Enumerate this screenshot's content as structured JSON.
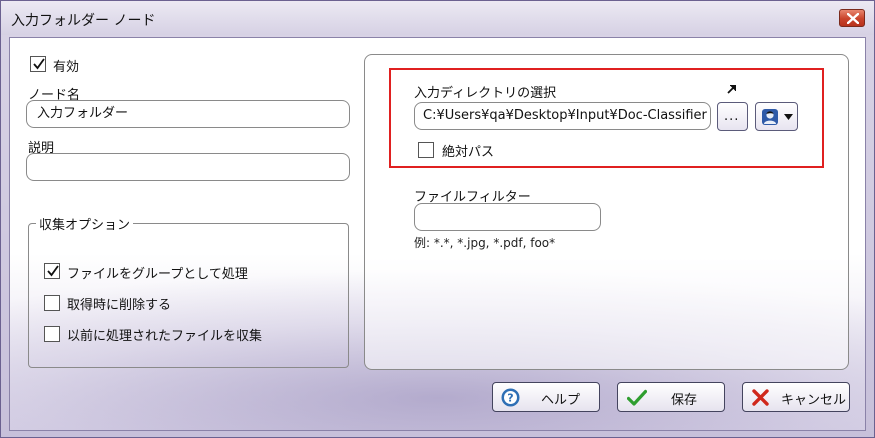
{
  "window": {
    "title": "入力フォルダー ノード"
  },
  "general": {
    "enabled_label": "有効",
    "enabled_checked": true,
    "node_name_label": "ノード名",
    "node_name_value": "入力フォルダー",
    "description_label": "説明",
    "description_value": ""
  },
  "collection_options": {
    "title": "収集オプション",
    "items": [
      {
        "label": "ファイルをグループとして処理",
        "checked": true
      },
      {
        "label": "取得時に削除する",
        "checked": false
      },
      {
        "label": "以前に処理されたファイルを収集",
        "checked": false
      }
    ]
  },
  "directory": {
    "label": "入力ディレクトリの選択",
    "path_value": "C:¥Users¥qa¥Desktop¥Input¥Doc-Classifier",
    "browse_label": "...",
    "absolute_path_label": "絶対パス",
    "absolute_path_checked": false
  },
  "file_filter": {
    "label": "ファイルフィルター",
    "value": "",
    "hint": "例: *.*, *.jpg, *.pdf, foo*"
  },
  "buttons": {
    "help": "ヘルプ",
    "save": "保存",
    "cancel": "キャンセル"
  },
  "colors": {
    "highlight": "#e02020",
    "save_check": "#2f9e2f",
    "cancel_x": "#d0281c",
    "help_icon": "#2e6fb5"
  }
}
